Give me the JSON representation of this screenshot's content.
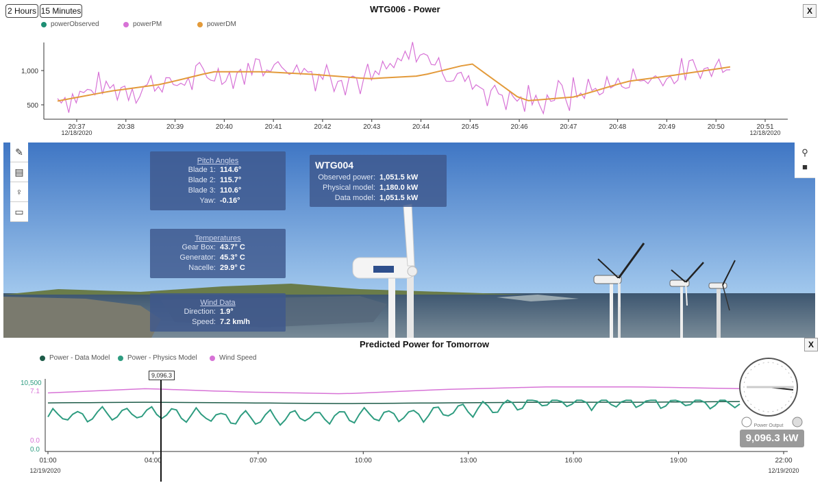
{
  "top": {
    "range_buttons": [
      "2 Hours",
      "15 Minutes"
    ],
    "title": "WTG006 - Power",
    "close_label": "X",
    "legend": [
      {
        "label": "powerObserved",
        "color": "#1e8f74"
      },
      {
        "label": "powerPM",
        "color": "#d772d6"
      },
      {
        "label": "powerDM",
        "color": "#e39a3a"
      }
    ],
    "y_ticks": [
      "1,000",
      "500"
    ],
    "x_ticks": [
      "20:37",
      "20:38",
      "20:39",
      "20:40",
      "20:41",
      "20:42",
      "20:43",
      "20:44",
      "20:45",
      "20:46",
      "20:47",
      "20:48",
      "20:49",
      "20:50",
      "20:51"
    ],
    "date_start": "12/18/2020",
    "date_end": "12/18/2020"
  },
  "scene": {
    "left_tools": [
      "ruler-icon",
      "layers-icon",
      "bulb-icon",
      "window-icon"
    ],
    "right_tools": [
      "person-icon",
      "camera-icon"
    ],
    "pitch": {
      "heading": "Pitch Angles",
      "rows": [
        {
          "k": "Blade 1:",
          "v": "114.6°"
        },
        {
          "k": "Blade 2:",
          "v": "115.7°"
        },
        {
          "k": "Blade 3:",
          "v": "110.6°"
        },
        {
          "k": "Yaw:",
          "v": "-0.16°"
        }
      ]
    },
    "temps": {
      "heading": "Temperatures",
      "rows": [
        {
          "k": "Gear Box:",
          "v": "43.7° C"
        },
        {
          "k": "Generator:",
          "v": "45.3° C"
        },
        {
          "k": "Nacelle:",
          "v": "29.9° C"
        }
      ]
    },
    "wind": {
      "heading": "Wind Data",
      "rows": [
        {
          "k": "Direction:",
          "v": "1.9°"
        },
        {
          "k": "Speed:",
          "v": "7.2 km/h"
        }
      ]
    },
    "wtg": {
      "title": "WTG004",
      "rows": [
        {
          "k": "Observed power:",
          "v": "1,051.5 kW"
        },
        {
          "k": "Physical model:",
          "v": "1,180.0 kW"
        },
        {
          "k": "Data model:",
          "v": "1,051.5 kW"
        }
      ]
    }
  },
  "bottom": {
    "title": "Predicted Power for Tomorrow",
    "close_label": "X",
    "legend": [
      {
        "label": "Power - Data Model",
        "color": "#1d5b48"
      },
      {
        "label": "Power - Physics Model",
        "color": "#2e9c80"
      },
      {
        "label": "Wind Speed",
        "color": "#d772d6"
      }
    ],
    "y_top_left": "10,500",
    "y_top_left2": "7.1",
    "y_zero_1": "0.0",
    "y_zero_2": "0.0",
    "x_ticks": [
      "01:00",
      "04:00",
      "07:00",
      "10:00",
      "13:00",
      "16:00",
      "19:00",
      "22:00"
    ],
    "date_start": "12/19/2020",
    "date_end": "12/19/2020",
    "cursor_value": "9,096.3",
    "gauge_label": "Power Output",
    "readout": "9,096.3 kW"
  },
  "chart_data": [
    {
      "type": "line",
      "title": "WTG006 - Power",
      "x": [
        "20:37",
        "20:38",
        "20:39",
        "20:40",
        "20:41",
        "20:42",
        "20:43",
        "20:44",
        "20:45",
        "20:46",
        "20:47",
        "20:48",
        "20:49",
        "20:50"
      ],
      "ylim": [
        300,
        1400
      ],
      "series": [
        {
          "name": "powerDM",
          "values": [
            560,
            700,
            800,
            980,
            980,
            940,
            880,
            920,
            1100,
            560,
            620,
            840,
            940,
            1050
          ]
        },
        {
          "name": "powerPM",
          "values": [
            600,
            760,
            780,
            900,
            1080,
            980,
            860,
            1240,
            820,
            560,
            640,
            840,
            900,
            1100
          ]
        }
      ]
    },
    {
      "type": "line",
      "title": "Predicted Power for Tomorrow",
      "x": [
        "01:00",
        "04:00",
        "07:00",
        "10:00",
        "13:00",
        "16:00",
        "19:00",
        "22:00"
      ],
      "series": [
        {
          "name": "Power - Data Model",
          "values": [
            7300,
            7400,
            7300,
            7200,
            7300,
            7400,
            7400,
            7500
          ]
        },
        {
          "name": "Power - Physics Model",
          "values": [
            5200,
            5800,
            5000,
            5400,
            5800,
            7600,
            7400,
            7400
          ]
        },
        {
          "name": "Wind Speed",
          "values": [
            6.9,
            7.4,
            7.0,
            6.8,
            7.3,
            7.6,
            7.6,
            7.4
          ]
        }
      ]
    }
  ]
}
